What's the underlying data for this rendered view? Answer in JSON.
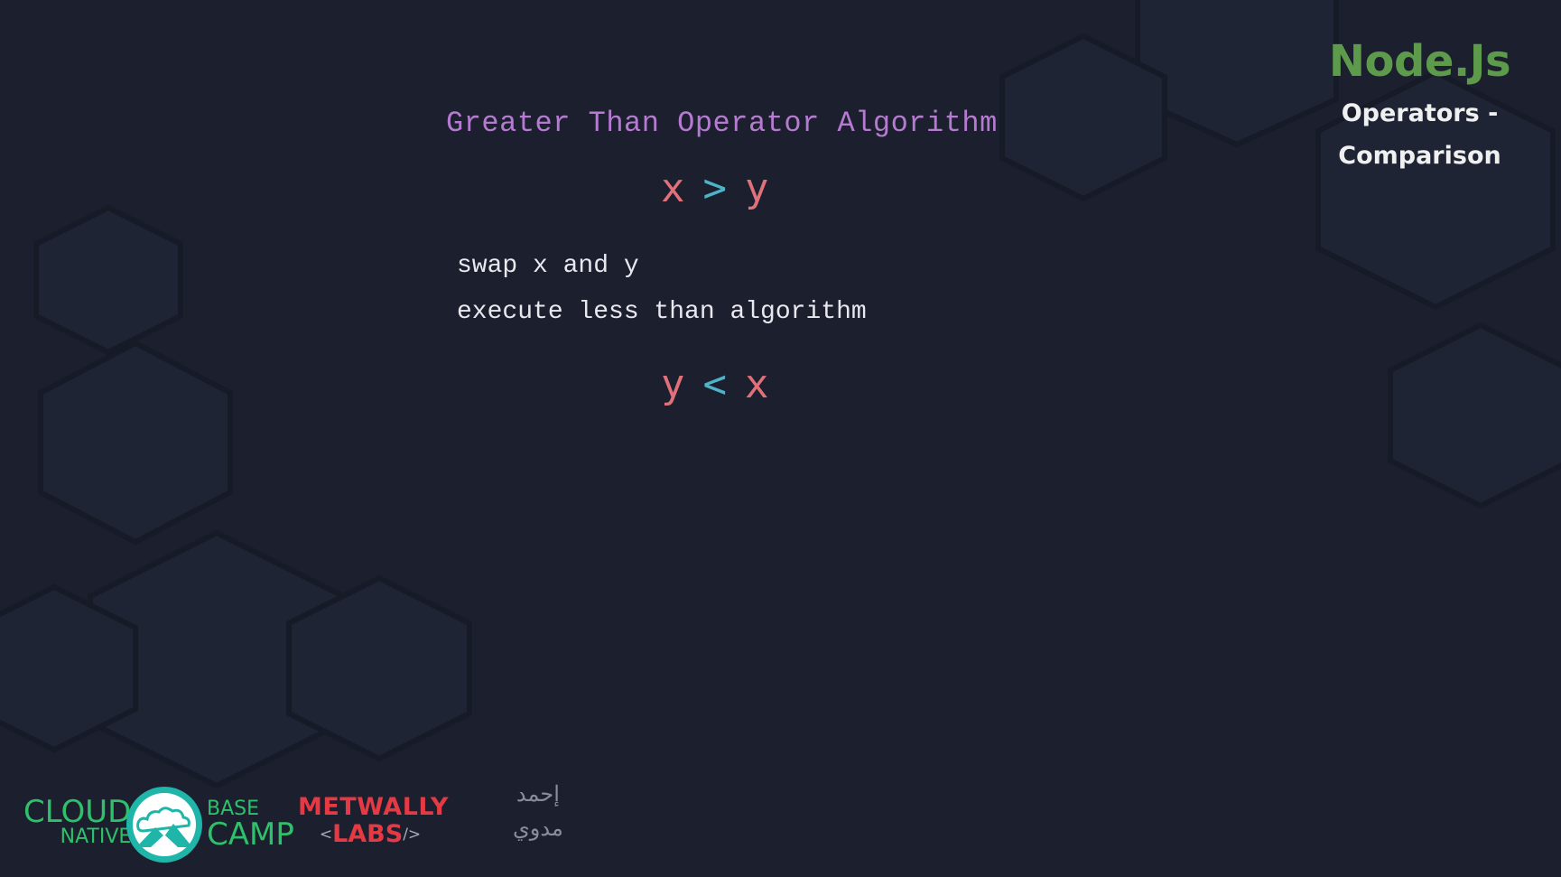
{
  "slide": {
    "title": "Greater Than Operator Algorithm",
    "expression_1": {
      "left": "x",
      "operator": ">",
      "right": "y"
    },
    "steps": [
      "swap x and y",
      "execute less than algorithm"
    ],
    "expression_2": {
      "left": "y",
      "operator": "<",
      "right": "x"
    }
  },
  "brand": {
    "name": "Node.Js",
    "subtitle_line1": "Operators -",
    "subtitle_line2": "Comparison"
  },
  "footer": {
    "cloud_native": {
      "cloud": "CLOUD",
      "native": "NATIVE",
      "base": "BASE",
      "camp": "CAMP",
      "icon": "mountain-cloud-logo-icon"
    },
    "metwally_labs": {
      "top": "METWALLY",
      "bottom": "LABS",
      "open_bracket": "<",
      "close_bracket": "/>"
    },
    "signature": {
      "line1": "إحمد",
      "line2": "مدوي"
    }
  },
  "colors": {
    "background": "#1b1f2e",
    "title": "#b57bd0",
    "variable": "#e0707a",
    "operator": "#4fb3c8",
    "brand_green": "#5d9a4b",
    "cloud_green": "#2fc06a",
    "metwally_red": "#e53944"
  }
}
